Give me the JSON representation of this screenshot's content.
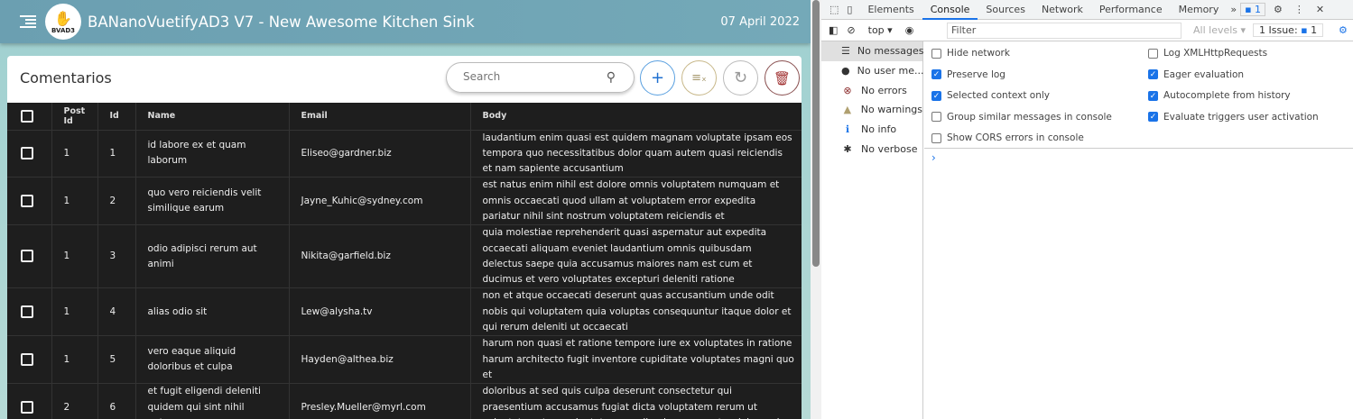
{
  "app": {
    "title": "BANanoVuetifyAD3 V7 - New Awesome Kitchen Sink",
    "date": "07 April 2022",
    "logo_text": "BVAD3"
  },
  "card": {
    "title": "Comentarios",
    "search_placeholder": "Search"
  },
  "table": {
    "headers": [
      "Post Id",
      "Id",
      "Name",
      "Email",
      "Body"
    ],
    "rows": [
      {
        "post_id": "1",
        "id": "1",
        "name": "id labore ex et quam laborum",
        "email": "Eliseo@gardner.biz",
        "body": "laudantium enim quasi est quidem magnam voluptate ipsam eos tempora quo necessitatibus dolor quam autem quasi reiciendis et nam sapiente accusantium"
      },
      {
        "post_id": "1",
        "id": "2",
        "name": "quo vero reiciendis velit similique earum",
        "email": "Jayne_Kuhic@sydney.com",
        "body": "est natus enim nihil est dolore omnis voluptatem numquam et omnis occaecati quod ullam at voluptatem error expedita pariatur nihil sint nostrum voluptatem reiciendis et"
      },
      {
        "post_id": "1",
        "id": "3",
        "name": "odio adipisci rerum aut animi",
        "email": "Nikita@garfield.biz",
        "body": "quia molestiae reprehenderit quasi aspernatur aut expedita occaecati aliquam eveniet laudantium omnis quibusdam delectus saepe quia accusamus maiores nam est cum et ducimus et vero voluptates excepturi deleniti ratione"
      },
      {
        "post_id": "1",
        "id": "4",
        "name": "alias odio sit",
        "email": "Lew@alysha.tv",
        "body": "non et atque occaecati deserunt quas accusantium unde odit nobis qui voluptatem quia voluptas consequuntur itaque dolor et qui rerum deleniti ut occaecati"
      },
      {
        "post_id": "1",
        "id": "5",
        "name": "vero eaque aliquid doloribus et culpa",
        "email": "Hayden@althea.biz",
        "body": "harum non quasi et ratione tempore iure ex voluptates in ratione harum architecto fugit inventore cupiditate voluptates magni quo et"
      },
      {
        "post_id": "2",
        "id": "6",
        "name": "et fugit eligendi deleniti quidem qui sint nihil autem",
        "email": "Presley.Mueller@myrl.com",
        "body": "doloribus at sed quis culpa deserunt consectetur qui praesentium accusamus fugiat dicta voluptatem rerum ut voluptate autem voluptatem repellendus aspernatur dolorem in"
      }
    ]
  },
  "devtools": {
    "tabs": [
      "Elements",
      "Console",
      "Sources",
      "Network",
      "Performance",
      "Memory"
    ],
    "issues_badge": "1",
    "context": "top",
    "filter_placeholder": "Filter",
    "levels": "All levels",
    "issues": "1 Issue:",
    "issues_count": "1",
    "sidebar": [
      "No messages",
      "No user me...",
      "No errors",
      "No warnings",
      "No info",
      "No verbose"
    ],
    "options_left": [
      {
        "label": "Hide network",
        "checked": false
      },
      {
        "label": "Preserve log",
        "checked": true
      },
      {
        "label": "Selected context only",
        "checked": true
      },
      {
        "label": "Group similar messages in console",
        "checked": false
      },
      {
        "label": "Show CORS errors in console",
        "checked": false
      }
    ],
    "options_right": [
      {
        "label": "Log XMLHttpRequests",
        "checked": false
      },
      {
        "label": "Eager evaluation",
        "checked": true
      },
      {
        "label": "Autocomplete from history",
        "checked": true
      },
      {
        "label": "Evaluate triggers user activation",
        "checked": true
      }
    ],
    "prompt": "›"
  }
}
